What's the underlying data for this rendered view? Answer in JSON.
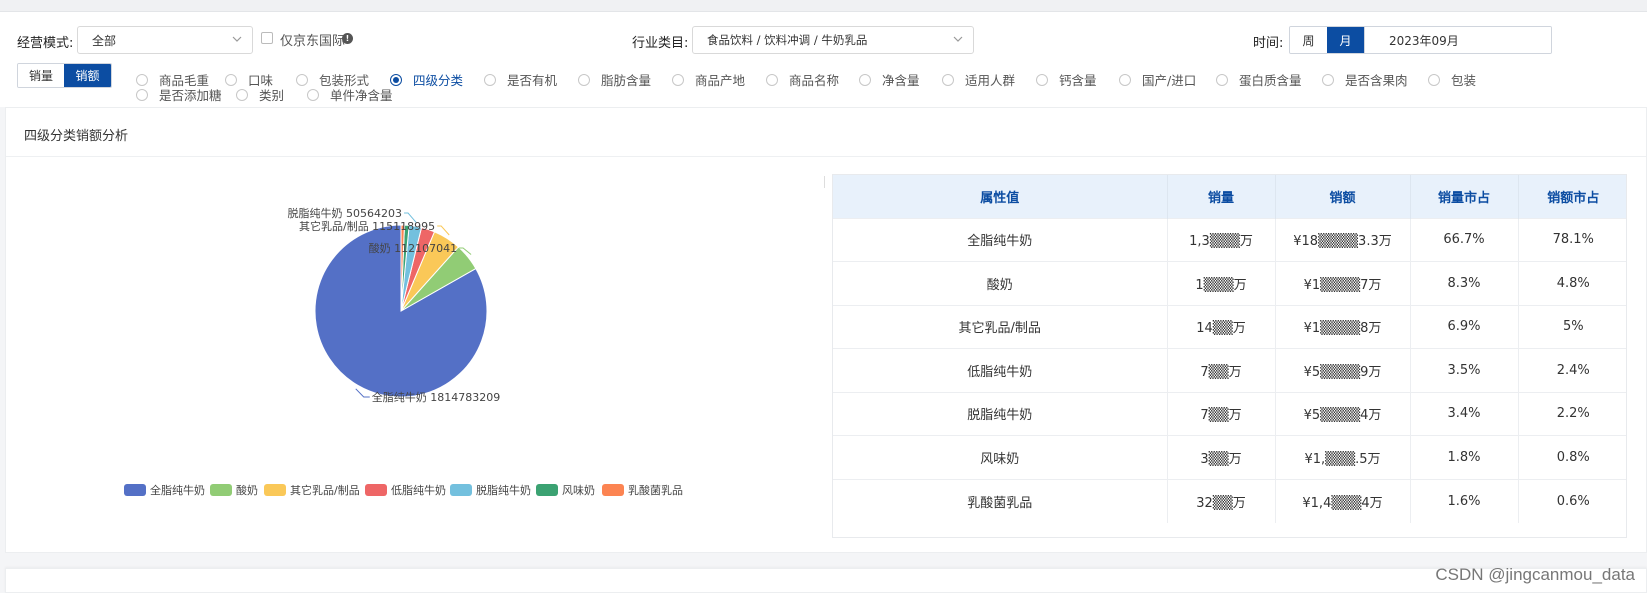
{
  "filters": {
    "mode_label": "经营模式:",
    "mode_value": "全部",
    "jd_intl_label": "仅京东国际",
    "industry_label": "行业类目:",
    "industry_value": "食品饮料 / 饮料冲调 / 牛奶乳品",
    "time_label": "时间:",
    "time_week": "周",
    "time_month": "月",
    "time_value": "2023年09月"
  },
  "metric_toggle": {
    "volume": "销量",
    "sales": "销额"
  },
  "attributes": [
    {
      "label": "商品毛重",
      "selected": false
    },
    {
      "label": "口味",
      "selected": false
    },
    {
      "label": "包装形式",
      "selected": false
    },
    {
      "label": "四级分类",
      "selected": true
    },
    {
      "label": "是否有机",
      "selected": false
    },
    {
      "label": "脂肪含量",
      "selected": false
    },
    {
      "label": "商品产地",
      "selected": false
    },
    {
      "label": "商品名称",
      "selected": false
    },
    {
      "label": "净含量",
      "selected": false
    },
    {
      "label": "适用人群",
      "selected": false
    },
    {
      "label": "钙含量",
      "selected": false
    },
    {
      "label": "国产/进口",
      "selected": false
    },
    {
      "label": "蛋白质含量",
      "selected": false
    },
    {
      "label": "是否含果肉",
      "selected": false
    },
    {
      "label": "包装",
      "selected": false
    },
    {
      "label": "是否添加糖",
      "selected": false
    },
    {
      "label": "类别",
      "selected": false
    },
    {
      "label": "单件净含量",
      "selected": false
    }
  ],
  "card": {
    "title": "四级分类销额分析"
  },
  "chart_data": {
    "type": "pie",
    "title": "",
    "categories": [
      "全脂纯牛奶",
      "酸奶",
      "其它乳品/制品",
      "低脂纯牛奶",
      "脱脂纯牛奶",
      "风味奶",
      "乳酸菌乳品"
    ],
    "values": [
      1814783209,
      112107041,
      115118995,
      55000000,
      50564203,
      19000000,
      14000000
    ],
    "value_labels": [
      "1814783209",
      "112107041",
      "115118995",
      "",
      "50564203",
      "",
      ""
    ],
    "colors": [
      "#5470c6",
      "#91cc75",
      "#fac858",
      "#ee6666",
      "#73c0de",
      "#3ba272",
      "#fc8452"
    ],
    "legend_position": "bottom"
  },
  "table": {
    "headers": [
      "属性值",
      "销量",
      "销额",
      "销量市占",
      "销额市占"
    ],
    "rows": [
      [
        "全脂纯牛奶",
        "1,3▒▒▒万",
        "¥18▒▒▒▒3.3万",
        "66.7%",
        "78.1%"
      ],
      [
        "酸奶",
        "1▒▒▒万",
        "¥1▒▒▒▒7万",
        "8.3%",
        "4.8%"
      ],
      [
        "其它乳品/制品",
        "14▒▒万",
        "¥1▒▒▒▒8万",
        "6.9%",
        "5%"
      ],
      [
        "低脂纯牛奶",
        "7▒▒万",
        "¥5▒▒▒▒9万",
        "3.5%",
        "2.4%"
      ],
      [
        "脱脂纯牛奶",
        "7▒▒万",
        "¥5▒▒▒▒4万",
        "3.4%",
        "2.2%"
      ],
      [
        "风味奶",
        "3▒▒万",
        "¥1,▒▒▒.5万",
        "1.8%",
        "0.8%"
      ],
      [
        "乳酸菌乳品",
        "32▒▒万",
        "¥1,4▒▒▒4万",
        "1.6%",
        "0.6%"
      ]
    ]
  },
  "watermark": "CSDN @jingcanmou_data"
}
